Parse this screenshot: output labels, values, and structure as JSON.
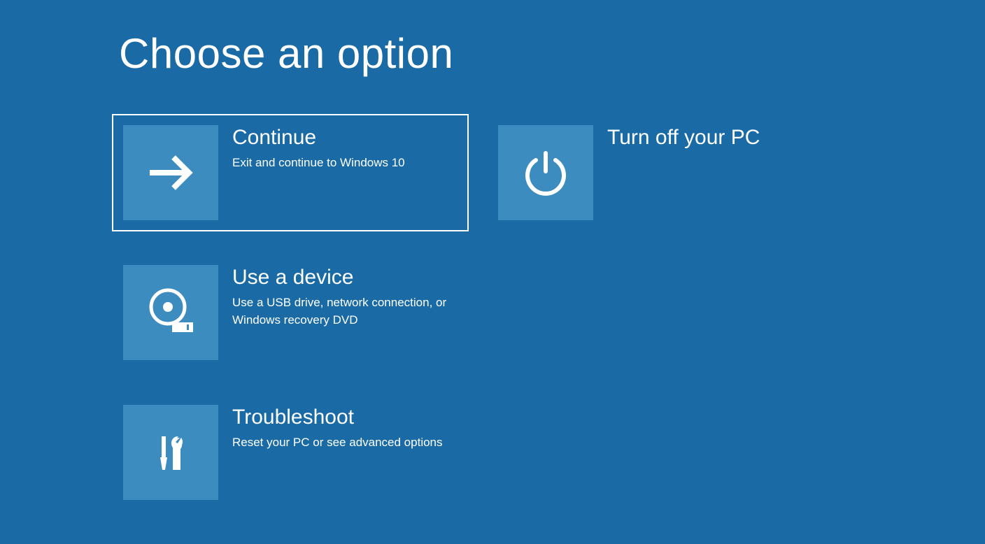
{
  "title": "Choose an option",
  "options": [
    {
      "title": "Continue",
      "description": "Exit and continue to Windows 10"
    },
    {
      "title": "Turn off your PC",
      "description": ""
    },
    {
      "title": "Use a device",
      "description": "Use a USB drive, network connection, or Windows recovery DVD"
    },
    {
      "title": "Troubleshoot",
      "description": "Reset your PC or see advanced options"
    }
  ]
}
